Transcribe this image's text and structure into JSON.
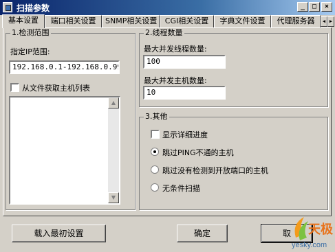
{
  "window": {
    "title": "扫描参数"
  },
  "tabs": [
    {
      "label": "基本设置"
    },
    {
      "label": "端口相关设置"
    },
    {
      "label": "SNMP相关设置"
    },
    {
      "label": "CGI相关设置"
    },
    {
      "label": "字典文件设置"
    },
    {
      "label": "代理服务器"
    }
  ],
  "scan_range": {
    "group_title": "1.检测范围",
    "ip_label": "指定IP范围:",
    "ip_value": "192.168.0.1-192.168.0.99",
    "from_file_label": "从文件获取主机列表",
    "from_file_checked": false
  },
  "threads": {
    "group_title": "2.线程数量",
    "max_threads_label": "最大并发线程数量:",
    "max_threads_value": "100",
    "max_hosts_label": "最大并发主机数量:",
    "max_hosts_value": "10"
  },
  "other": {
    "group_title": "3.其他",
    "show_progress_label": "显示详细进度",
    "show_progress_checked": false,
    "options": [
      {
        "label": "跳过PING不通的主机",
        "selected": true
      },
      {
        "label": "跳过没有检测到开放端口的主机",
        "selected": false
      },
      {
        "label": "无条件扫描",
        "selected": false
      }
    ]
  },
  "buttons": {
    "load_defaults": "载入最初设置",
    "ok": "确定",
    "cancel": "取"
  },
  "watermark": {
    "brand": "天极",
    "site": "yesky.com"
  }
}
